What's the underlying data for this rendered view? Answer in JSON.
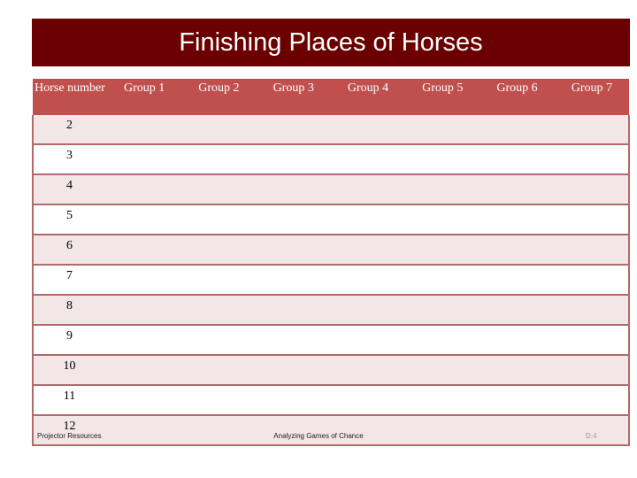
{
  "title": "Finishing Places of Horses",
  "table": {
    "headers": [
      "Horse number",
      "Group 1",
      "Group 2",
      "Group 3",
      "Group 4",
      "Group 5",
      "Group 6",
      "Group 7"
    ],
    "rows": [
      {
        "horse": "2",
        "values": [
          "",
          "",
          "",
          "",
          "",
          "",
          ""
        ]
      },
      {
        "horse": "3",
        "values": [
          "",
          "",
          "",
          "",
          "",
          "",
          ""
        ]
      },
      {
        "horse": "4",
        "values": [
          "",
          "",
          "",
          "",
          "",
          "",
          ""
        ]
      },
      {
        "horse": "5",
        "values": [
          "",
          "",
          "",
          "",
          "",
          "",
          ""
        ]
      },
      {
        "horse": "6",
        "values": [
          "",
          "",
          "",
          "",
          "",
          "",
          ""
        ]
      },
      {
        "horse": "7",
        "values": [
          "",
          "",
          "",
          "",
          "",
          "",
          ""
        ]
      },
      {
        "horse": "8",
        "values": [
          "",
          "",
          "",
          "",
          "",
          "",
          ""
        ]
      },
      {
        "horse": "9",
        "values": [
          "",
          "",
          "",
          "",
          "",
          "",
          ""
        ]
      },
      {
        "horse": "10",
        "values": [
          "",
          "",
          "",
          "",
          "",
          "",
          ""
        ]
      },
      {
        "horse": "11",
        "values": [
          "",
          "",
          "",
          "",
          "",
          "",
          ""
        ]
      },
      {
        "horse": "12",
        "values": [
          "",
          "",
          "",
          "",
          "",
          "",
          ""
        ]
      }
    ]
  },
  "footer": {
    "left": "Projector Resources",
    "center": "Analyzing Games of Chance",
    "page": "D.4"
  },
  "colors": {
    "title_bg": "#6b0000",
    "header_bg": "#c0504d",
    "row_alt_bg": "#f2e6e6",
    "border": "#b06a6a"
  }
}
